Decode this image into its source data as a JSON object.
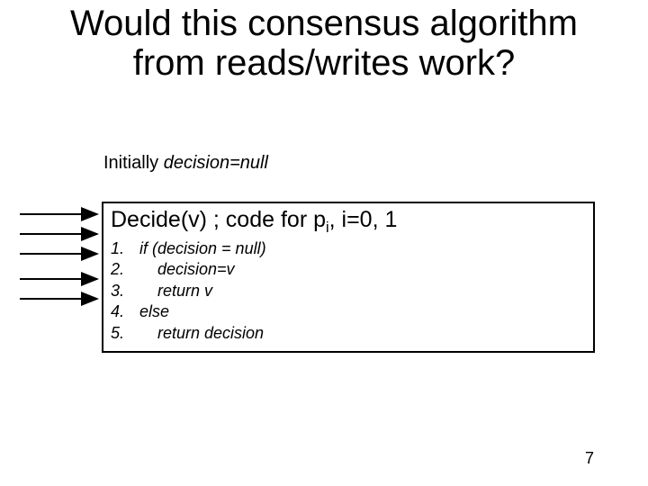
{
  "title_line1": "Would this consensus algorithm",
  "title_line2": "from reads/writes work?",
  "initially_prefix": "Initially ",
  "initially_expr": "decision=null",
  "code_header": "Decide(v)  ; code for p",
  "code_header_sub": "i",
  "code_header_tail": ", i=0, 1",
  "lines": {
    "l1": {
      "n": "1.",
      "t": "  if (decision = null)"
    },
    "l2": {
      "n": "2.",
      "t": "      decision=v"
    },
    "l3": {
      "n": "3.",
      "t": "      return v"
    },
    "l4": {
      "n": "4.",
      "t": "  else"
    },
    "l5": {
      "n": "5.",
      "t": "      return decision"
    }
  },
  "page_number": "7"
}
